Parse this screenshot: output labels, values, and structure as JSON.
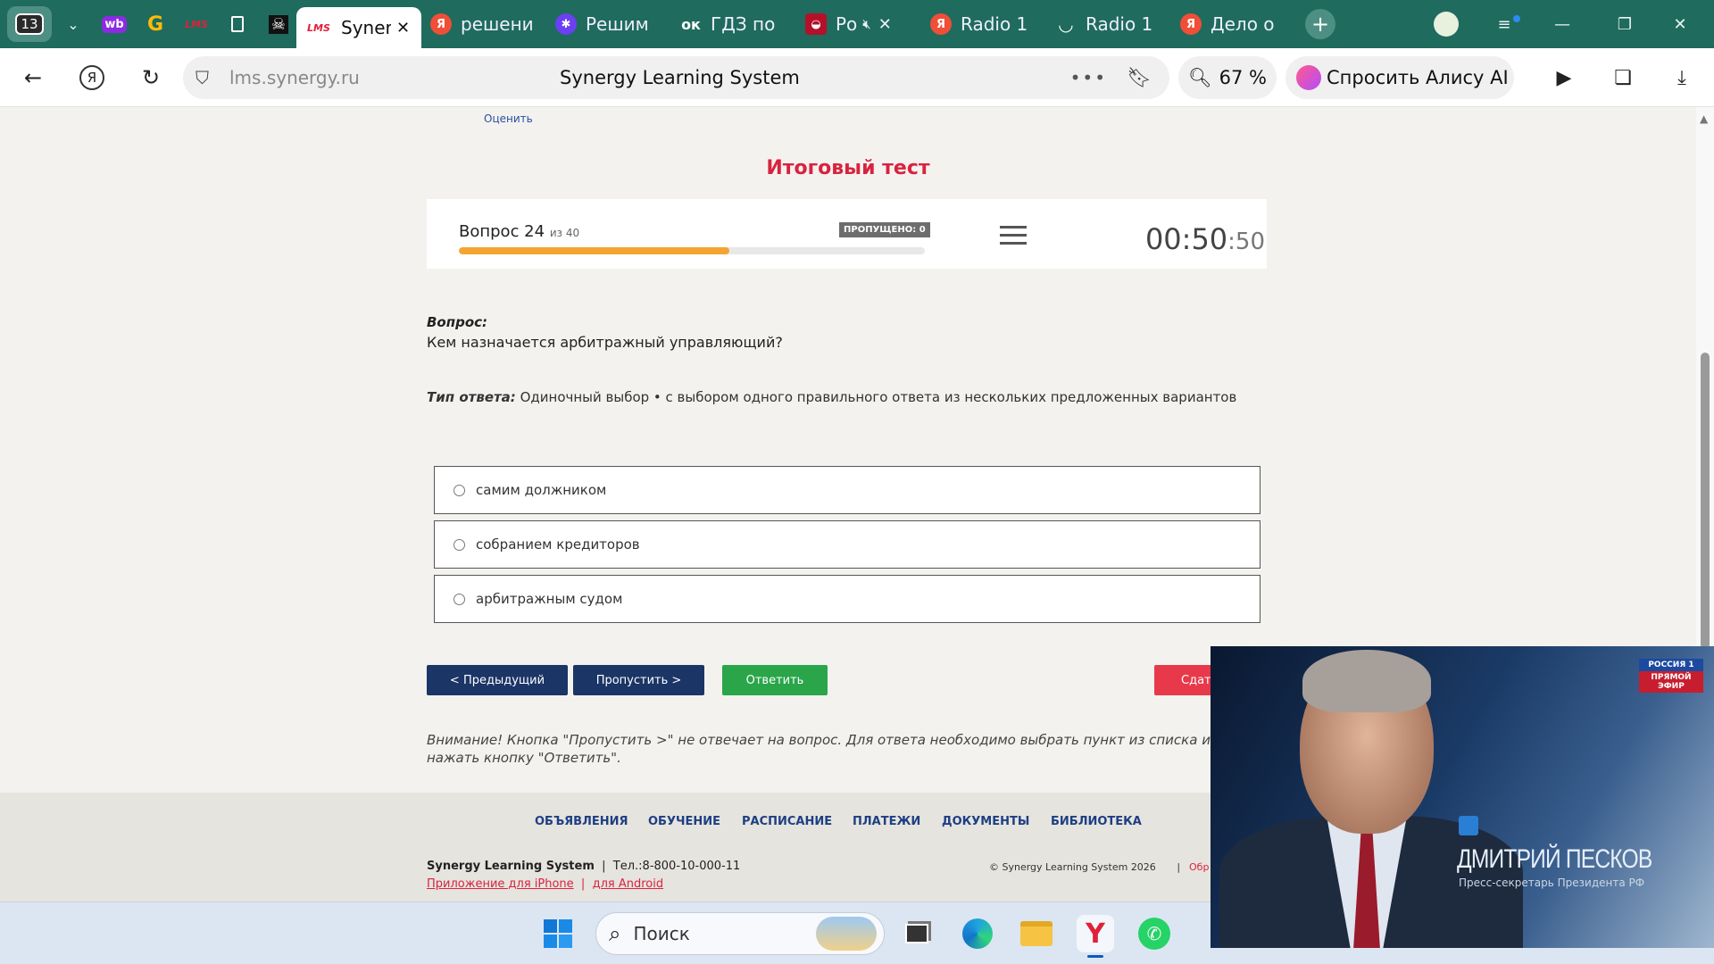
{
  "browser": {
    "tab_count": "13",
    "tabs": [
      {
        "label": "Synergy",
        "icon_text": "LMS",
        "active": true
      },
      {
        "label": "решени",
        "icon_text": "Я"
      },
      {
        "label": "Решим",
        "icon_text": "✱"
      },
      {
        "label": "ГДЗ по",
        "icon_text": "ок"
      },
      {
        "label": "Ро",
        "icon_text": "◒"
      },
      {
        "label": "Radio 1",
        "icon_text": "Я"
      },
      {
        "label": "Radio 1",
        "icon_text": "◡"
      },
      {
        "label": "Дело о",
        "icon_text": "Я"
      }
    ],
    "pinned": [
      "wb",
      "G",
      "LMS",
      "doc",
      "☠"
    ],
    "url_domain": "lms.synergy.ru",
    "page_title": "Synergy Learning System",
    "zoom": "67 %",
    "alice_label": "Спросить Алису AI"
  },
  "page": {
    "rate_link": "Оценить",
    "test_title": "Итоговый тест",
    "question_counter": "Вопрос 24",
    "question_total": "из 40",
    "skipped_badge": "ПРОПУЩЕНО: 0",
    "progress": 0.58,
    "timer_main": "00:50",
    "timer_seconds": ":50",
    "question_label": "Вопрос:",
    "question_text": "Кем назначается арбитражный управляющий?",
    "answer_type_label": "Тип ответа:",
    "answer_type_text": " Одиночный выбор • с выбором одного правильного ответа из нескольких предложенных вариантов",
    "options": [
      "самим должником",
      "собранием кредиторов",
      "арбитражным судом"
    ],
    "buttons": {
      "prev": "< Предыдущий",
      "skip": "Пропустить >",
      "answer": "Ответить",
      "submit": "Сдать"
    },
    "warning": "Внимание! Кнопка \"Пропустить >\" не отвечает на вопрос. Для ответа необходимо выбрать пункт из списка и нажать кнопку \"Ответить\".",
    "colors": {
      "accent": "#d8233f",
      "navy": "#1a3566",
      "green": "#2aa54a",
      "progress": "#f4a531"
    }
  },
  "footer": {
    "nav": [
      "ОБЪЯВЛЕНИЯ",
      "ОБУЧЕНИЕ",
      "РАСПИСАНИЕ",
      "ПЛАТЕЖИ",
      "ДОКУМЕНТЫ",
      "БИБЛИОТЕКА"
    ],
    "brand": "Synergy Learning System",
    "phone": "Тел.:8-800-10-000-11",
    "iphone_link": "Приложение для iPhone",
    "android_link": "для Android",
    "copyright": "© Synergy Learning System 2026",
    "cut_link": "Обр"
  },
  "taskbar": {
    "search_placeholder": "Поиск"
  },
  "video": {
    "name": "ДМИТРИЙ ПЕСКОВ",
    "role": "Пресс-секретарь Президента РФ",
    "channel": "РОССИЯ 1",
    "live": "ПРЯМОЙ ЭФИР"
  }
}
